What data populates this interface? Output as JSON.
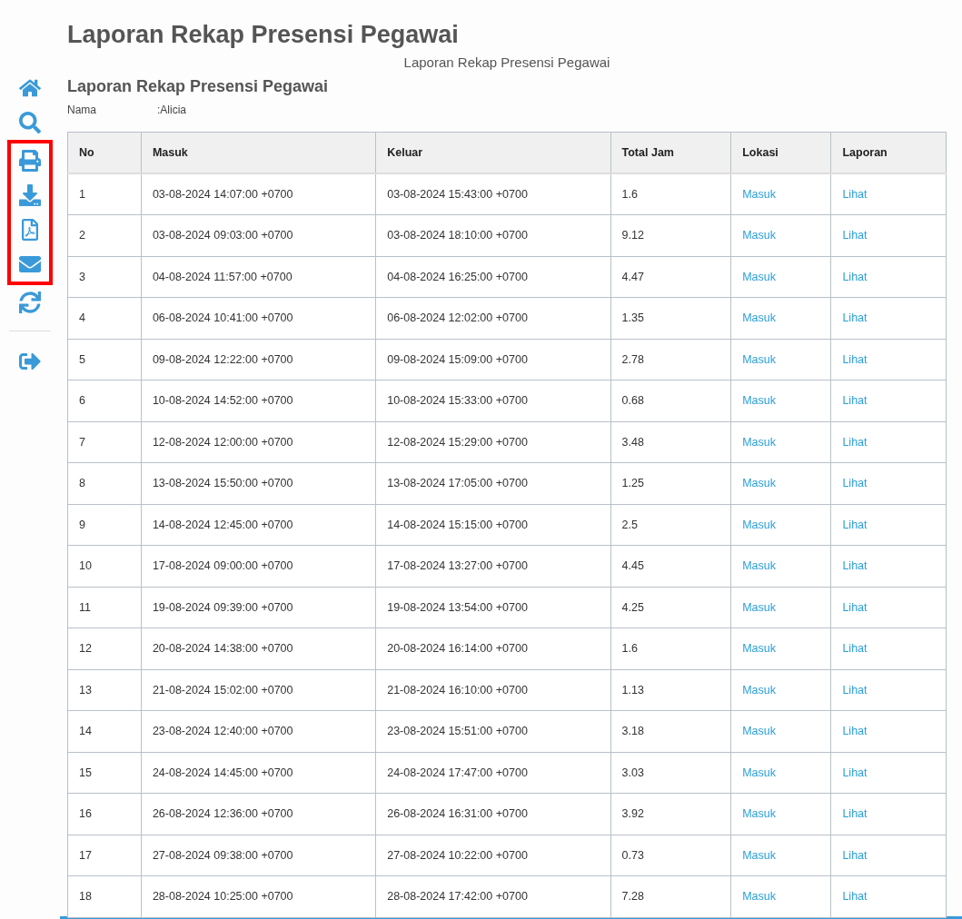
{
  "page_title": "Laporan Rekap Presensi Pegawai",
  "report_caption": "Laporan Rekap Presensi Pegawai",
  "report_heading": "Laporan Rekap Presensi Pegawai",
  "employee": {
    "label": "Nama",
    "value": ":Alicia"
  },
  "sidebar": {
    "items": [
      {
        "kind": "home",
        "highlighted": false
      },
      {
        "kind": "search",
        "highlighted": false
      },
      {
        "kind": "print",
        "highlighted": true
      },
      {
        "kind": "download",
        "highlighted": true
      },
      {
        "kind": "pdf",
        "highlighted": true
      },
      {
        "kind": "email",
        "highlighted": true
      },
      {
        "kind": "refresh",
        "highlighted": false
      },
      {
        "kind": "divider",
        "highlighted": false
      },
      {
        "kind": "logout",
        "highlighted": false
      }
    ]
  },
  "table": {
    "columns": [
      "No",
      "Masuk",
      "Keluar",
      "Total Jam",
      "Lokasi",
      "Laporan"
    ],
    "rows": [
      [
        "1",
        "03-08-2024 14:07:00 +0700",
        "03-08-2024 15:43:00 +0700",
        "1.6",
        "Masuk",
        "Lihat"
      ],
      [
        "2",
        "03-08-2024 09:03:00 +0700",
        "03-08-2024 18:10:00 +0700",
        "9.12",
        "Masuk",
        "Lihat"
      ],
      [
        "3",
        "04-08-2024 11:57:00 +0700",
        "04-08-2024 16:25:00 +0700",
        "4.47",
        "Masuk",
        "Lihat"
      ],
      [
        "4",
        "06-08-2024 10:41:00 +0700",
        "06-08-2024 12:02:00 +0700",
        "1.35",
        "Masuk",
        "Lihat"
      ],
      [
        "5",
        "09-08-2024 12:22:00 +0700",
        "09-08-2024 15:09:00 +0700",
        "2.78",
        "Masuk",
        "Lihat"
      ],
      [
        "6",
        "10-08-2024 14:52:00 +0700",
        "10-08-2024 15:33:00 +0700",
        "0.68",
        "Masuk",
        "Lihat"
      ],
      [
        "7",
        "12-08-2024 12:00:00 +0700",
        "12-08-2024 15:29:00 +0700",
        "3.48",
        "Masuk",
        "Lihat"
      ],
      [
        "8",
        "13-08-2024 15:50:00 +0700",
        "13-08-2024 17:05:00 +0700",
        "1.25",
        "Masuk",
        "Lihat"
      ],
      [
        "9",
        "14-08-2024 12:45:00 +0700",
        "14-08-2024 15:15:00 +0700",
        "2.5",
        "Masuk",
        "Lihat"
      ],
      [
        "10",
        "17-08-2024 09:00:00 +0700",
        "17-08-2024 13:27:00 +0700",
        "4.45",
        "Masuk",
        "Lihat"
      ],
      [
        "11",
        "19-08-2024 09:39:00 +0700",
        "19-08-2024 13:54:00 +0700",
        "4.25",
        "Masuk",
        "Lihat"
      ],
      [
        "12",
        "20-08-2024 14:38:00 +0700",
        "20-08-2024 16:14:00 +0700",
        "1.6",
        "Masuk",
        "Lihat"
      ],
      [
        "13",
        "21-08-2024 15:02:00 +0700",
        "21-08-2024 16:10:00 +0700",
        "1.13",
        "Masuk",
        "Lihat"
      ],
      [
        "14",
        "23-08-2024 12:40:00 +0700",
        "23-08-2024 15:51:00 +0700",
        "3.18",
        "Masuk",
        "Lihat"
      ],
      [
        "15",
        "24-08-2024 14:45:00 +0700",
        "24-08-2024 17:47:00 +0700",
        "3.03",
        "Masuk",
        "Lihat"
      ],
      [
        "16",
        "26-08-2024 12:36:00 +0700",
        "26-08-2024 16:31:00 +0700",
        "3.92",
        "Masuk",
        "Lihat"
      ],
      [
        "17",
        "27-08-2024 09:38:00 +0700",
        "27-08-2024 10:22:00 +0700",
        "0.73",
        "Masuk",
        "Lihat"
      ],
      [
        "18",
        "28-08-2024 10:25:00 +0700",
        "28-08-2024 17:42:00 +0700",
        "7.28",
        "Masuk",
        "Lihat"
      ]
    ]
  }
}
